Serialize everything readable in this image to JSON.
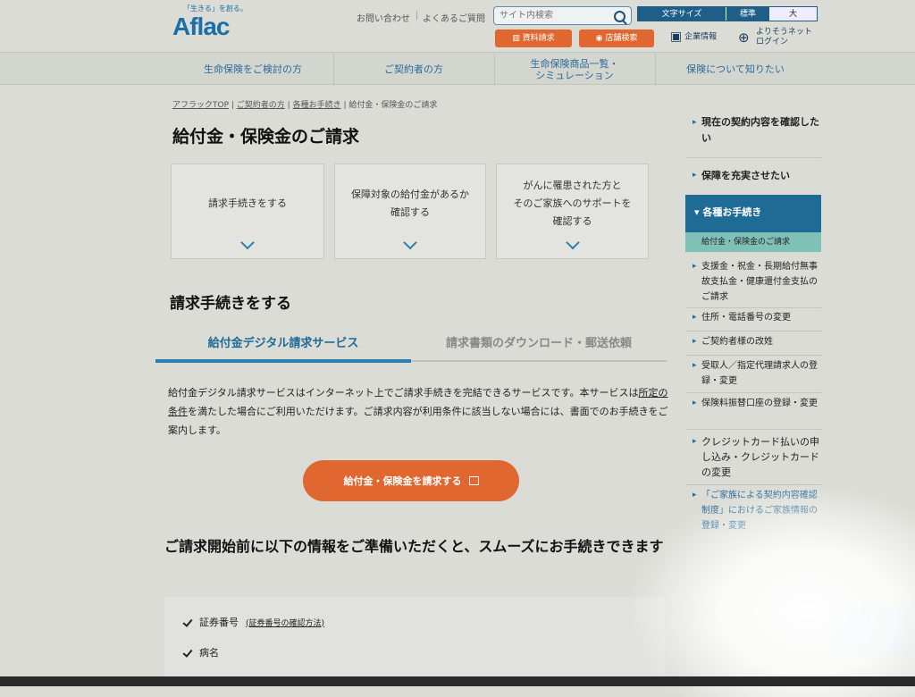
{
  "header": {
    "tagline": "「生きる」を創る。",
    "logo": "Aflac",
    "links": [
      "お問い合わせ",
      "よくあるご質問"
    ],
    "search_placeholder": "サイト内検索",
    "fontsize_label": "文字サイズ",
    "fontsize_standard": "標準",
    "fontsize_large": "大",
    "document_request": "資料請求",
    "store_search": "店舗検索",
    "corporate_info": "企業情報",
    "yorisou_login_1": "よりそうネット",
    "yorisou_login_2": "ログイン"
  },
  "nav": [
    "生命保険をご検討の方",
    "ご契約者の方",
    "生命保険商品一覧・\nシミュレーション",
    "保険について知りたい"
  ],
  "breadcrumb": [
    "アフラックTOP",
    "ご契約者の方",
    "各種お手続き",
    "給付金・保険金のご請求"
  ],
  "page_title": "給付金・保険金のご請求",
  "cards": [
    "請求手続きをする",
    "保障対象の給付金があるか\n確認する",
    "がんに罹患された方と\nそのご家族へのサポートを\n確認する"
  ],
  "section_title": "請求手続きをする",
  "tabs": [
    "給付金デジタル請求サービス",
    "請求書類のダウンロード・郵送依頼"
  ],
  "description": {
    "part1": "給付金デジタル請求サービスはインターネット上でご請求手続きを完結できるサービスです。本サービスは",
    "link": "所定の条件",
    "part2": "を満たした場合にご利用いただけます。ご請求内容が利用条件に該当しない場合には、書面でのお手続きをご案内します。"
  },
  "claim_button": "給付金・保険金を請求する",
  "prep_title": "ご請求開始前に以下の情報をご準備いただくと、スムーズにお手続きできます",
  "checklist": [
    {
      "label": "証券番号",
      "link": "(証券番号の確認方法)"
    },
    {
      "label": "病名",
      "link": ""
    }
  ],
  "sidebar": {
    "items": [
      "現在の契約内容を確認したい",
      "保障を充実させたい"
    ],
    "active_header": "▾ 各種お手続き",
    "current": "給付金・保険金のご請求",
    "subitems": [
      "支援金・祝金・長期給付無事故支払金・健康還付金支払のご請求",
      "住所・電話番号の変更",
      "ご契約者様の改姓",
      "受取人／指定代理請求人の登録・変更",
      "保険料振替口座の登録・変更",
      "クレジットカード払いの申し込み・クレジットカードの変更",
      "「ご家族による契約内容確認制度」におけるご家族情報の登録・変更"
    ]
  },
  "colors": {
    "brand": "#1a6fa8",
    "accent": "#e0672f",
    "nav_active": "#1e6b96",
    "current_item": "#7fc1b6"
  }
}
